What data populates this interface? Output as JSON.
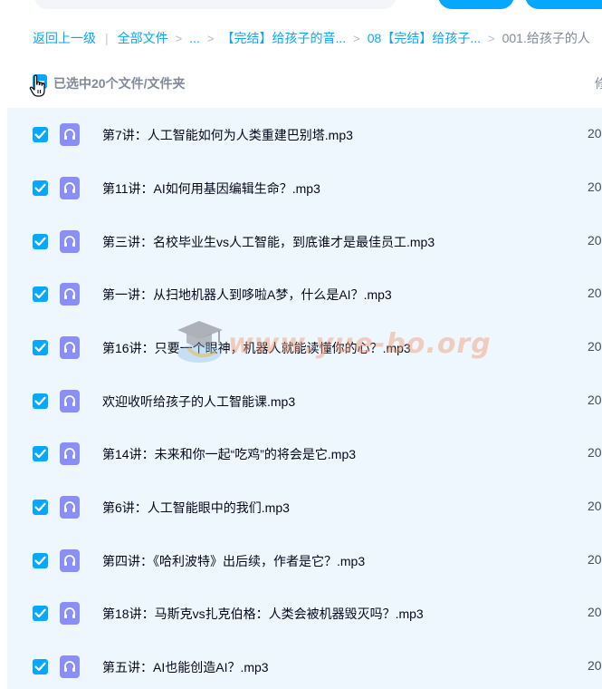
{
  "breadcrumb": {
    "back": "返回上一级",
    "all_files": "全部文件",
    "ellipsis": "...",
    "folder1": "【完结】给孩子的音...",
    "folder2": "08【完结】给孩子...",
    "current": "001.给孩子的人"
  },
  "header": {
    "selected_label": "已选中20个文件/文件夹",
    "right_col_fragment": "修"
  },
  "files": [
    {
      "name": "第7讲：人工智能如何为人类重建巴别塔.mp3",
      "date_fragment": "20"
    },
    {
      "name": "第11讲：AI如何用基因编辑生命？.mp3",
      "date_fragment": "20"
    },
    {
      "name": "第三讲：名校毕业生vs人工智能，到底谁才是最佳员工.mp3",
      "date_fragment": "20"
    },
    {
      "name": "第一讲：从扫地机器人到哆啦A梦，什么是AI？.mp3",
      "date_fragment": "20"
    },
    {
      "name": "第16讲：只要一个眼神，机器人就能读懂你的心？.mp3",
      "date_fragment": "20"
    },
    {
      "name": "欢迎收听给孩子的人工智能课.mp3",
      "date_fragment": "20"
    },
    {
      "name": "第14讲：未来和你一起“吃鸡”的将会是它.mp3",
      "date_fragment": "20"
    },
    {
      "name": "第6讲：人工智能眼中的我们.mp3",
      "date_fragment": "20"
    },
    {
      "name": "第四讲：《哈利波特》出后续，作者是它？.mp3",
      "date_fragment": "20"
    },
    {
      "name": "第18讲：马斯克vs扎克伯格：人类会被机器毁灭吗？.mp3",
      "date_fragment": "20"
    },
    {
      "name": "第五讲：AI也能创造AI？.mp3",
      "date_fragment": "20"
    }
  ],
  "watermark": {
    "text": "www.yue-bo.org",
    "icon": "graduation-cap-icon"
  },
  "colors": {
    "accent": "#06a7ff",
    "row_selected_bg": "#eef7fe",
    "audio_icon": "#8a8ff7",
    "text_primary": "#03081a",
    "text_secondary": "#818999"
  }
}
